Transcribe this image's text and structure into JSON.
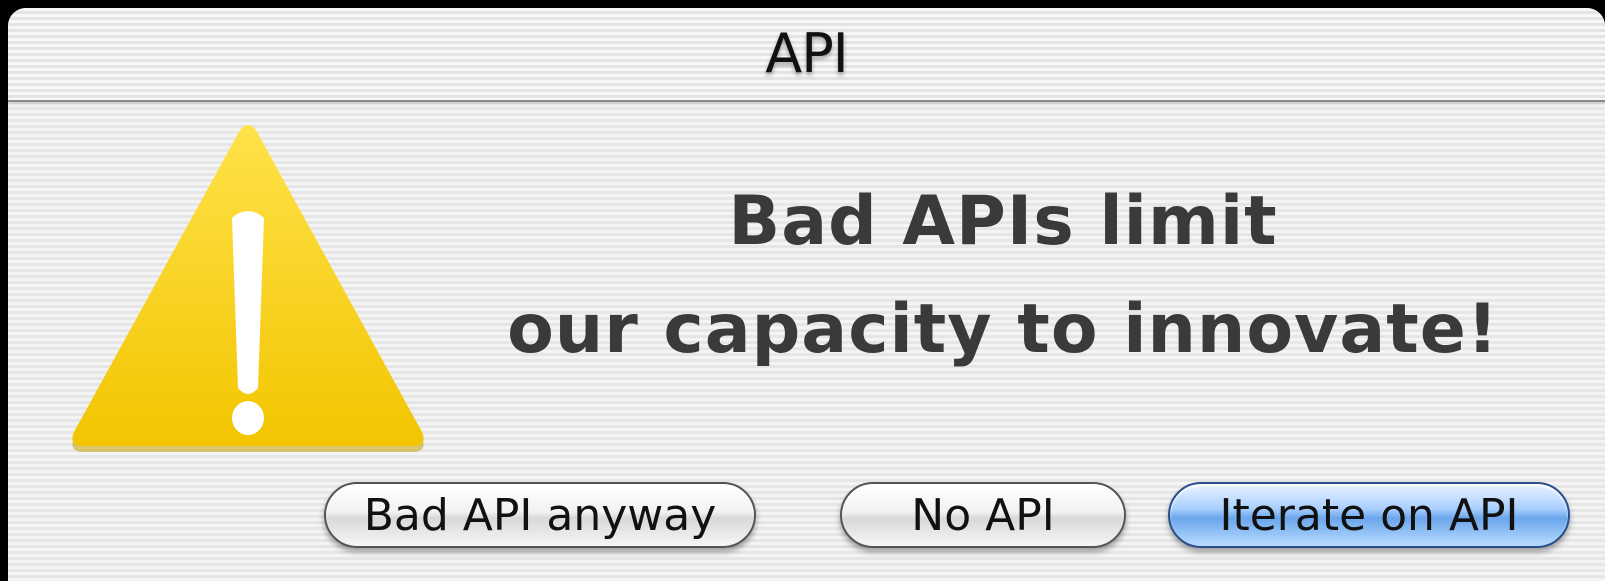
{
  "window": {
    "title": "API"
  },
  "alert": {
    "icon": "warning-icon",
    "message_line1": "Bad APIs limit",
    "message_line2": "our capacity to innovate!"
  },
  "buttons": {
    "bad_api_anyway": "Bad API anyway",
    "no_api": "No API",
    "iterate_on_api": "Iterate on API"
  },
  "colors": {
    "warning_yellow": "#f5cf00",
    "default_button_blue": "#6aa6ec"
  }
}
